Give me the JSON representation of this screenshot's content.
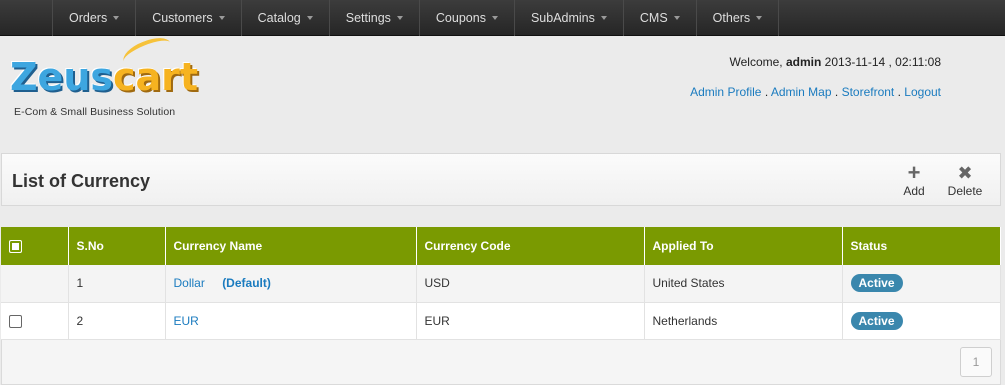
{
  "nav": {
    "items": [
      {
        "label": "Orders"
      },
      {
        "label": "Customers"
      },
      {
        "label": "Catalog"
      },
      {
        "label": "Settings"
      },
      {
        "label": "Coupons"
      },
      {
        "label": "SubAdmins"
      },
      {
        "label": "CMS"
      },
      {
        "label": "Others"
      }
    ]
  },
  "logo": {
    "part1": "Zeus",
    "part2": "cart",
    "tagline": "E-Com & Small Business Solution"
  },
  "header": {
    "welcome_prefix": "Welcome,",
    "username": "admin",
    "datetime": "2013-11-14 , 02:11:08",
    "links": {
      "admin_profile": "Admin Profile",
      "admin_map": "Admin Map",
      "storefront": "Storefront",
      "logout": "Logout",
      "separator": "."
    }
  },
  "panel": {
    "title": "List of Currency",
    "add_label": "Add",
    "delete_label": "Delete",
    "add_icon": "+",
    "delete_icon": "✖"
  },
  "table": {
    "headers": {
      "sno": "S.No",
      "currency_name": "Currency Name",
      "currency_code": "Currency Code",
      "applied_to": "Applied To",
      "status": "Status"
    },
    "rows": [
      {
        "sno": "1",
        "name": "Dollar",
        "default_tag": "(Default)",
        "code": "USD",
        "applied_to": "United States",
        "status": "Active",
        "has_checkbox": false
      },
      {
        "sno": "2",
        "name": "EUR",
        "default_tag": "",
        "code": "EUR",
        "applied_to": "Netherlands",
        "status": "Active",
        "has_checkbox": true
      }
    ]
  },
  "pagination": {
    "current_page": "1"
  },
  "colors": {
    "header_green": "#7a9a01",
    "link_blue": "#1a7bbf",
    "badge_blue": "#3a87ad",
    "nav_bg": "#2e2e2e"
  }
}
